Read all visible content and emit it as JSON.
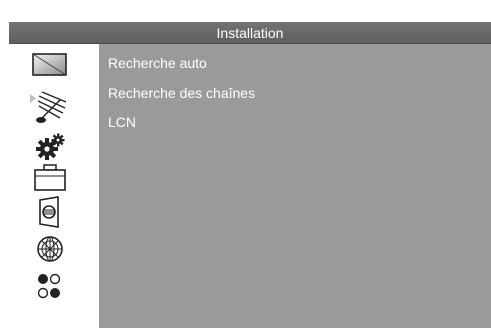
{
  "header": {
    "title": "Installation"
  },
  "sidebar": {
    "items": [
      {
        "icon": "tv-picture-icon",
        "selected": false
      },
      {
        "icon": "antenna-dish-icon",
        "selected": true
      },
      {
        "icon": "gears-icon",
        "selected": false
      },
      {
        "icon": "briefcase-icon",
        "selected": false
      },
      {
        "icon": "speaker-icon",
        "selected": false
      },
      {
        "icon": "globe-icon",
        "selected": false
      },
      {
        "icon": "color-dots-icon",
        "selected": false
      }
    ]
  },
  "menu": {
    "items": [
      {
        "label": "Recherche auto"
      },
      {
        "label": "Recherche des chaînes"
      },
      {
        "label": "LCN"
      }
    ]
  },
  "colors": {
    "panel": "#9a9a9a",
    "titlebar": "#666666",
    "sidebar": "#ffffff",
    "text": "#ffffff"
  }
}
